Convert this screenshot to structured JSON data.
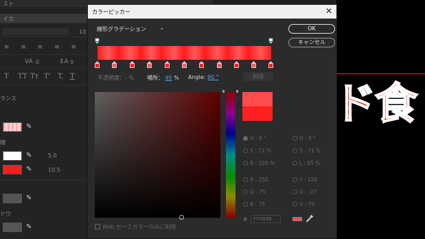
{
  "background_panel": {
    "header_fragment_1": "スト",
    "header_fragment_2": "イカ",
    "size_value": "10",
    "kerning_value": "0",
    "tracking_value": "0",
    "type_styles": [
      "T",
      "TT",
      "Tт",
      "T'",
      "T,",
      "T"
    ],
    "section_balance": "ランス",
    "section_stroke": "線",
    "stroke_width_1": "5.0",
    "stroke_width_2": "10.5",
    "section_shadow": "ドウ"
  },
  "dialog": {
    "title": "カラーピッカー",
    "gradient_type": "線形グラデーション",
    "ok_label": "OK",
    "cancel_label": "キャンセル",
    "opacity_label": "不透明度：- %",
    "location_label": "場所：",
    "location_value": "95",
    "location_unit": "%",
    "angle_label": "Angle:",
    "angle_value": "90 °",
    "delete_label": "削除",
    "hsb": {
      "h": "H : 0 °",
      "s": "S : 71 %",
      "b": "B : 100 %"
    },
    "hsl": {
      "h": "H : 0 °",
      "s": "S : 71 %",
      "l": "L : 65 %"
    },
    "rgb": {
      "r": "R : 255",
      "g": "G : 75",
      "b": "B : 75"
    },
    "yuv": {
      "y": "Y : 126",
      "u": "U : -27",
      "v": "V : 79"
    },
    "hex_prefix": "#",
    "hex_value": "FF4B4B",
    "web_safe_label": "Web セーフカラーのみに制限"
  },
  "canvas_text": "ド食",
  "colors": {
    "current": "#FF4B4B",
    "previous": "#FF2020",
    "gradient_stop_a": "#FF1C1C",
    "gradient_stop_b": "#FF5A5A"
  }
}
